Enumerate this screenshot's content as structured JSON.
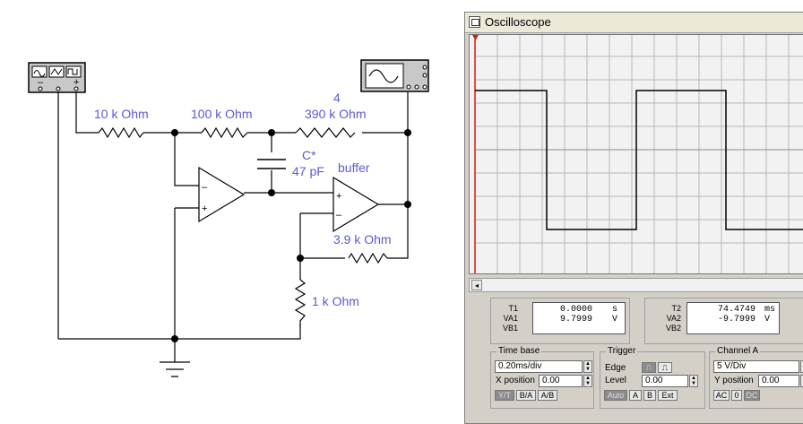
{
  "schematic": {
    "r_10k": "10 k Ohm",
    "r_100k": "100 k Ohm",
    "r_390k_ref": "4",
    "r_390k": "390 k Ohm",
    "cap_ref": "C*",
    "cap_val": "47 pF",
    "buffer_label": "buffer",
    "r_3_9k": "3.9 k Ohm",
    "r_1k": "1 k Ohm",
    "opamp_minus": "–",
    "opamp_plus": "+"
  },
  "oscilloscope": {
    "title": "Oscilloscope",
    "scroll_left": "◂",
    "cursor1": {
      "t_label": "T1",
      "va_label": "VA1",
      "vb_label": "VB1",
      "t_value": "0.0000",
      "t_unit": "s",
      "va_value": "9.7999",
      "va_unit": "V"
    },
    "cursor2": {
      "t_label": "T2",
      "va_label": "VA2",
      "vb_label": "VB2",
      "t_value": "74.4749",
      "t_unit": "ms",
      "va_value": "-9.7999",
      "va_unit": "V"
    },
    "timebase": {
      "title": "Time base",
      "value": "0.20ms/div",
      "xpos_label": "X position",
      "xpos_value": "0.00",
      "btn_yt": "Y/T",
      "btn_ba": "B/A",
      "btn_ab": "A/B"
    },
    "trigger": {
      "title": "Trigger",
      "edge_label": "Edge",
      "edge_rise": "⎍",
      "edge_fall": "⎍",
      "level_label": "Level",
      "level_value": "0.00",
      "btn_auto": "Auto",
      "btn_a": "A",
      "btn_b": "B",
      "btn_ext": "Ext"
    },
    "channel_a": {
      "title": "Channel A",
      "value": "5 V/Div",
      "ypos_label": "Y position",
      "ypos_value": "0.00",
      "btn_ac": "AC",
      "btn_0": "0",
      "btn_dc": "DC"
    }
  }
}
